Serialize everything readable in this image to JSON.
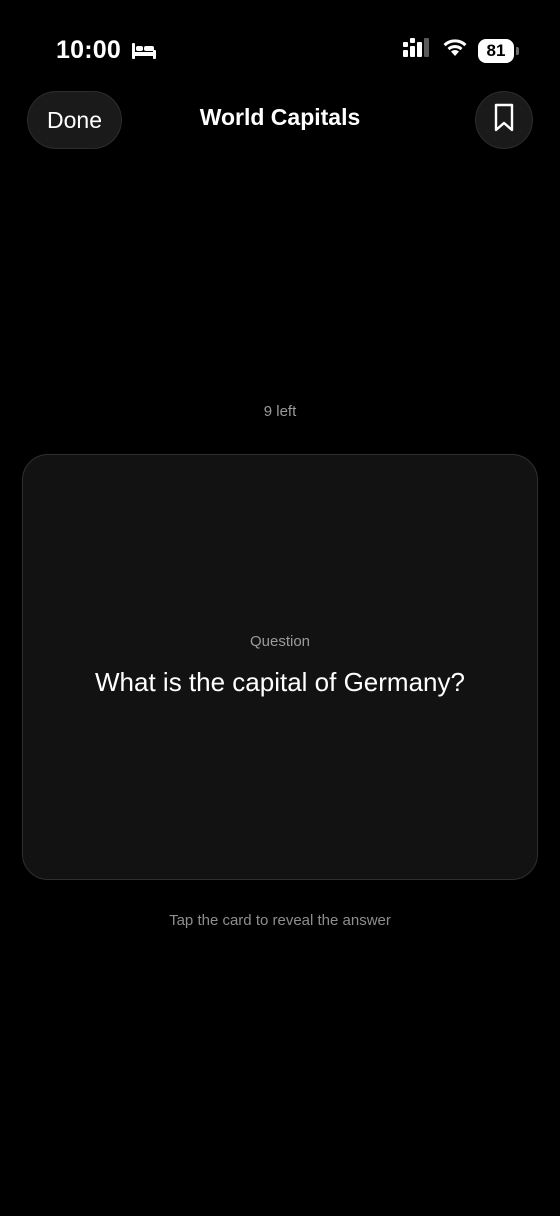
{
  "status_bar": {
    "time": "10:00",
    "battery_level": "81",
    "icons": [
      "bed-icon",
      "cellular-signal-icon",
      "wifi-icon",
      "battery-icon"
    ]
  },
  "nav": {
    "done_label": "Done",
    "title": "World Capitals",
    "bookmark_icon": "bookmark-icon"
  },
  "deck": {
    "remaining": "9 left"
  },
  "card": {
    "label": "Question",
    "text": "What is the capital of Germany?"
  },
  "hint": "Tap the card to reveal the answer",
  "colors": {
    "background": "#000000",
    "card_background": "#121212",
    "card_border": "#2f2f2f",
    "button_background": "#1a1a1a",
    "secondary_text": "#9a9a9a"
  }
}
